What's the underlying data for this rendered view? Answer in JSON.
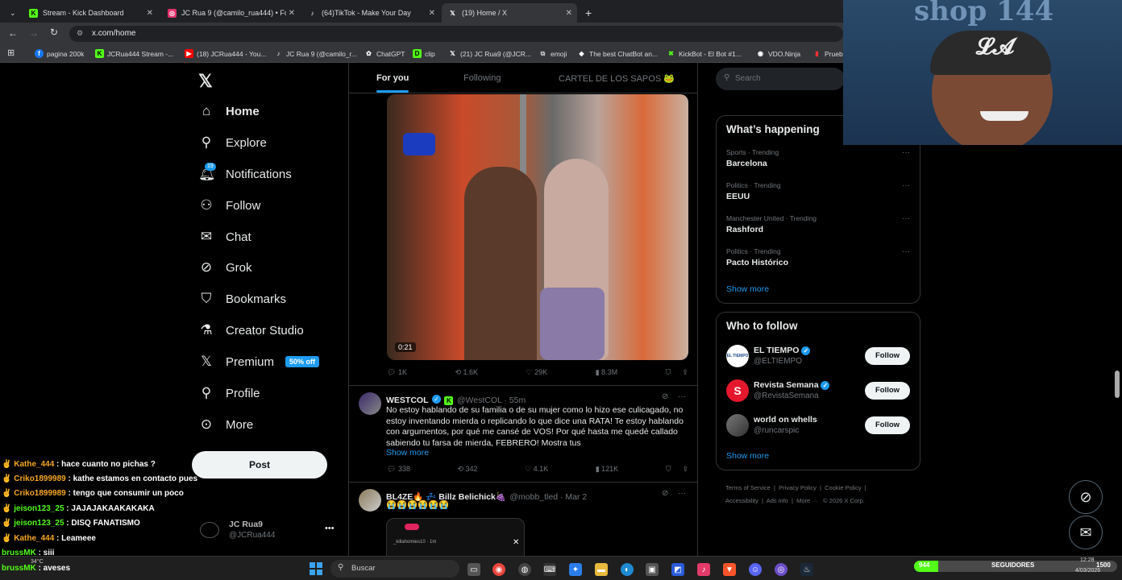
{
  "browser": {
    "tabs": [
      {
        "title": "Stream - Kick Dashboard",
        "icon": "kick-icon",
        "color": "#53fc18"
      },
      {
        "title": "JC Rua 9 (@camilo_rua444) • Fo",
        "icon": "instagram-icon",
        "color": "#e1306c"
      },
      {
        "title": "(64)TikTok - Make Your Day",
        "icon": "tiktok-icon",
        "color": "#ffffff"
      },
      {
        "title": "(19) Home / X",
        "icon": "x-icon",
        "color": "#ffffff"
      }
    ],
    "url": "x.com/home",
    "bookmarks": [
      {
        "label": "pagina 200k",
        "icon": "facebook-icon"
      },
      {
        "label": "JCRua444 Stream -...",
        "icon": "kick-icon"
      },
      {
        "label": "(18) JCRua444 - You...",
        "icon": "youtube-icon"
      },
      {
        "label": "JC Rua 9 (@camilo_r...",
        "icon": "tiktok-icon"
      },
      {
        "label": "ChatGPT",
        "icon": "chatgpt-icon"
      },
      {
        "label": "clip",
        "icon": "clip-icon"
      },
      {
        "label": "(21) JC Rua9 (@JCR...",
        "icon": "x-icon"
      },
      {
        "label": "emoji",
        "icon": "bookmark-icon"
      },
      {
        "label": "The best ChatBot an...",
        "icon": "chatbot-icon"
      },
      {
        "label": "KickBot - El Bot #1...",
        "icon": "kickbot-icon"
      },
      {
        "label": "VDO.Ninja",
        "icon": "vdo-icon"
      },
      {
        "label": "Prueb",
        "icon": "bookmark-icon"
      }
    ]
  },
  "nav": {
    "items": [
      {
        "label": "Home",
        "icon": "home-icon",
        "glyph": "⌂"
      },
      {
        "label": "Explore",
        "icon": "search-icon",
        "glyph": "⚲"
      },
      {
        "label": "Notifications",
        "icon": "bell-icon",
        "glyph": "♫",
        "badge": "19"
      },
      {
        "label": "Follow",
        "icon": "follow-icon",
        "glyph": "⚇"
      },
      {
        "label": "Chat",
        "icon": "mail-icon",
        "glyph": "✉"
      },
      {
        "label": "Grok",
        "icon": "grok-icon",
        "glyph": "⊘"
      },
      {
        "label": "Bookmarks",
        "icon": "bookmark-icon",
        "glyph": "⛉"
      },
      {
        "label": "Creator Studio",
        "icon": "creator-icon",
        "glyph": "⚗"
      },
      {
        "label": "Premium",
        "icon": "x-premium-icon",
        "glyph": "𝕏",
        "badge": "50% off"
      },
      {
        "label": "Profile",
        "icon": "profile-icon",
        "glyph": "⚲"
      },
      {
        "label": "More",
        "icon": "more-icon",
        "glyph": "⊙"
      }
    ],
    "post_label": "Post",
    "account": {
      "name": "JC Rua9",
      "handle": "@JCRua444"
    }
  },
  "feed": {
    "tabs": [
      "For you",
      "Following",
      "CARTEL DE LOS SAPOS 🐸"
    ],
    "video": {
      "duration": "0:21",
      "replies": "1K",
      "reposts": "1.6K",
      "likes": "29K",
      "views": "8.3M"
    },
    "posts": [
      {
        "name": "WESTCOL",
        "handle": "@WestCOL · 55m",
        "text": "No estoy hablando de su familia o de su mujer como lo hizo ese culicagado, no estoy inventando mierda o replicando lo que dice una RATA! Te estoy hablando con argumentos, por qué me cansé de VOS! Por qué hasta me quedé callado sabiendo tu farsa de mierda, FEBRERO! Mostra tus",
        "show_more": "Show more",
        "replies": "338",
        "reposts": "342",
        "likes": "4.1K",
        "views": "121K"
      },
      {
        "name": "BL4ZE🔥 💤 Billz Belichick🍇",
        "handle": "@mobb_tled · Mar 2",
        "text": "😭😭😭😭😭😭"
      }
    ],
    "embed_handle": "_killahomies10 · 1m"
  },
  "right": {
    "search_placeholder": "Search",
    "happening_title": "What’s happening",
    "trends": [
      {
        "context": "Sports · Trending",
        "topic": "Barcelona"
      },
      {
        "context": "Politics · Trending",
        "topic": "EEUU"
      },
      {
        "context": "Manchester United · Trending",
        "topic": "Rashford"
      },
      {
        "context": "Politics · Trending",
        "topic": "Pacto Histórico"
      }
    ],
    "show_more": "Show more",
    "wtf_title": "Who to follow",
    "who_to_follow": [
      {
        "name": "EL TIEMPO",
        "handle": "@ELTIEMPO",
        "avatar_color": "#ffffff",
        "avatar_text": "EL TIEMPO"
      },
      {
        "name": "Revista Semana",
        "handle": "@RevistaSemana",
        "avatar_color": "#e5172d",
        "avatar_text": "S"
      },
      {
        "name": "world on whells",
        "handle": "@runcarspic",
        "avatar_color": "#555555",
        "avatar_text": ""
      }
    ],
    "follow_label": "Follow",
    "footer_links": [
      "Terms of Service",
      "Privacy Policy",
      "Cookie Policy",
      "Accessibility",
      "Ads info",
      "More ···",
      "© 2026 X Corp."
    ]
  },
  "stream_overlay": {
    "cam_text": "shop 144",
    "chat": [
      {
        "user": "Kathe_444",
        "msg": " : hace cuanto no pichas ?",
        "color": "#f5a623"
      },
      {
        "user": "Criko1899989",
        "msg": " : kathe estamos en contacto pues",
        "color": "#f5a623"
      },
      {
        "user": "Criko1899989",
        "msg": " : tengo que consumir un poco",
        "color": "#f5a623"
      },
      {
        "user": "jeison123_25",
        "msg": " : JAJAJAKAAKAKAKA",
        "color": "#53fc18"
      },
      {
        "user": "jeison123_25",
        "msg": " : DISQ FANATISMO",
        "color": "#53fc18"
      },
      {
        "user": "Kathe_444",
        "msg": " : Leameee",
        "color": "#f5a623"
      },
      {
        "user": "brussMK",
        "msg": " : siii",
        "color": "#53fc18"
      },
      {
        "user": "brussMK",
        "msg": " : aveses",
        "color": "#53fc18"
      }
    ]
  },
  "taskbar": {
    "search_placeholder": "Buscar",
    "followers_count": "944",
    "followers_label": "SEGUIDORES",
    "followers_goal": "1500",
    "time": "12:28",
    "date": "4/03/2026",
    "weather": "34°C"
  }
}
